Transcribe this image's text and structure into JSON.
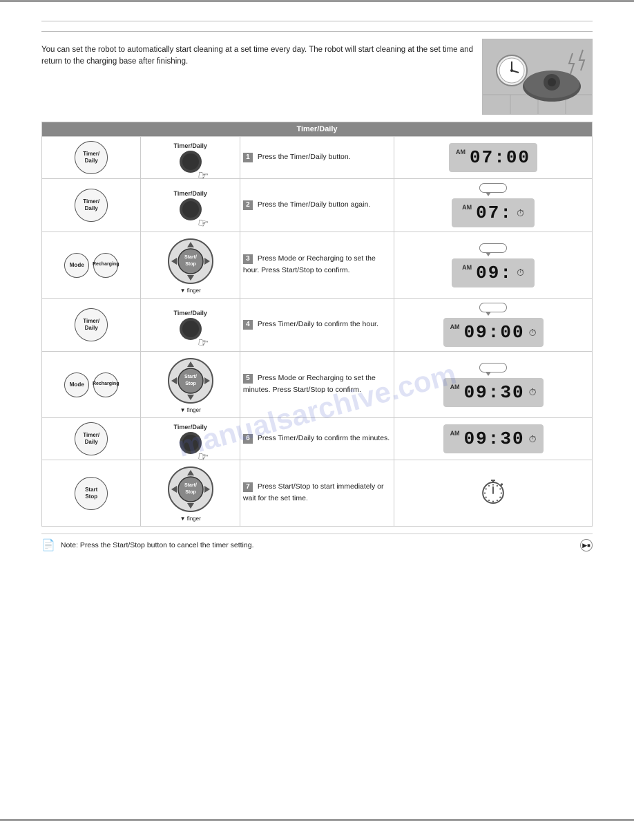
{
  "page": {
    "title": "Timer Daily",
    "section_title": "Timer/Daily",
    "watermark": "manualsarchive.com"
  },
  "intro": {
    "text": "You can set the robot to automatically start cleaning at a set time every day. The robot will start cleaning at the set time and return to the charging base after finishing."
  },
  "steps": [
    {
      "num": "1",
      "button_label": "Timer/\nDaily",
      "press_label": "Timer/Daily",
      "desc": "Press the Timer/Daily button.",
      "display_type": "time",
      "display_time": "07:00",
      "display_am": "AM",
      "show_timer_icon": false,
      "show_bubble": false,
      "bubble_text": ""
    },
    {
      "num": "2",
      "button_label": "Timer/\nDaily",
      "press_label": "Timer/Daily",
      "desc": "Press the Timer/Daily button again.",
      "display_type": "partial",
      "display_time": "07:",
      "display_am": "AM",
      "show_timer_icon": true,
      "show_bubble": true,
      "bubble_text": ""
    },
    {
      "num": "3",
      "button_label_left": "Mode",
      "button_label_right": "Recharging",
      "press_label": "Start/\nStop",
      "desc": "Press Mode or Recharging to set the hour. Press Start/Stop to confirm.",
      "display_type": "partial",
      "display_time": "09:",
      "display_am": "AM",
      "show_timer_icon": true,
      "show_bubble": true,
      "bubble_text": "",
      "use_ring": true
    },
    {
      "num": "4",
      "button_label": "Timer/\nDaily",
      "press_label": "Timer/Daily",
      "desc": "Press Timer/Daily to confirm the hour.",
      "display_type": "time",
      "display_time": "09:00",
      "display_am": "AM",
      "show_timer_icon": true,
      "show_bubble": true,
      "bubble_text": ""
    },
    {
      "num": "5",
      "button_label_left": "Mode",
      "button_label_right": "Recharging",
      "press_label": "Start/\nStop",
      "desc": "Press Mode or Recharging to set the minutes. Press Start/Stop to confirm.",
      "display_type": "time",
      "display_time": "09:30",
      "display_am": "AM",
      "show_timer_icon": true,
      "show_bubble": true,
      "bubble_text": "",
      "use_ring": true
    },
    {
      "num": "6",
      "button_label": "Timer/\nDaily",
      "press_label": "Timer/Daily",
      "desc": "Press Timer/Daily to confirm the minutes.",
      "display_type": "time",
      "display_time": "09:30",
      "display_am": "AM",
      "show_timer_icon": true,
      "show_bubble": false,
      "bubble_text": ""
    },
    {
      "num": "7",
      "button_label": "Start\nStop",
      "press_label": "Start/\nStop",
      "desc": "Press Start/Stop to start immediately or wait for the set time.",
      "display_type": "icon_only",
      "display_time": "",
      "display_am": "",
      "show_timer_icon": false,
      "show_bubble": false,
      "use_ring": true
    }
  ],
  "footer": {
    "note": "Note: Press the Start/Stop button to cancel the timer setting.",
    "icon": "📄"
  }
}
